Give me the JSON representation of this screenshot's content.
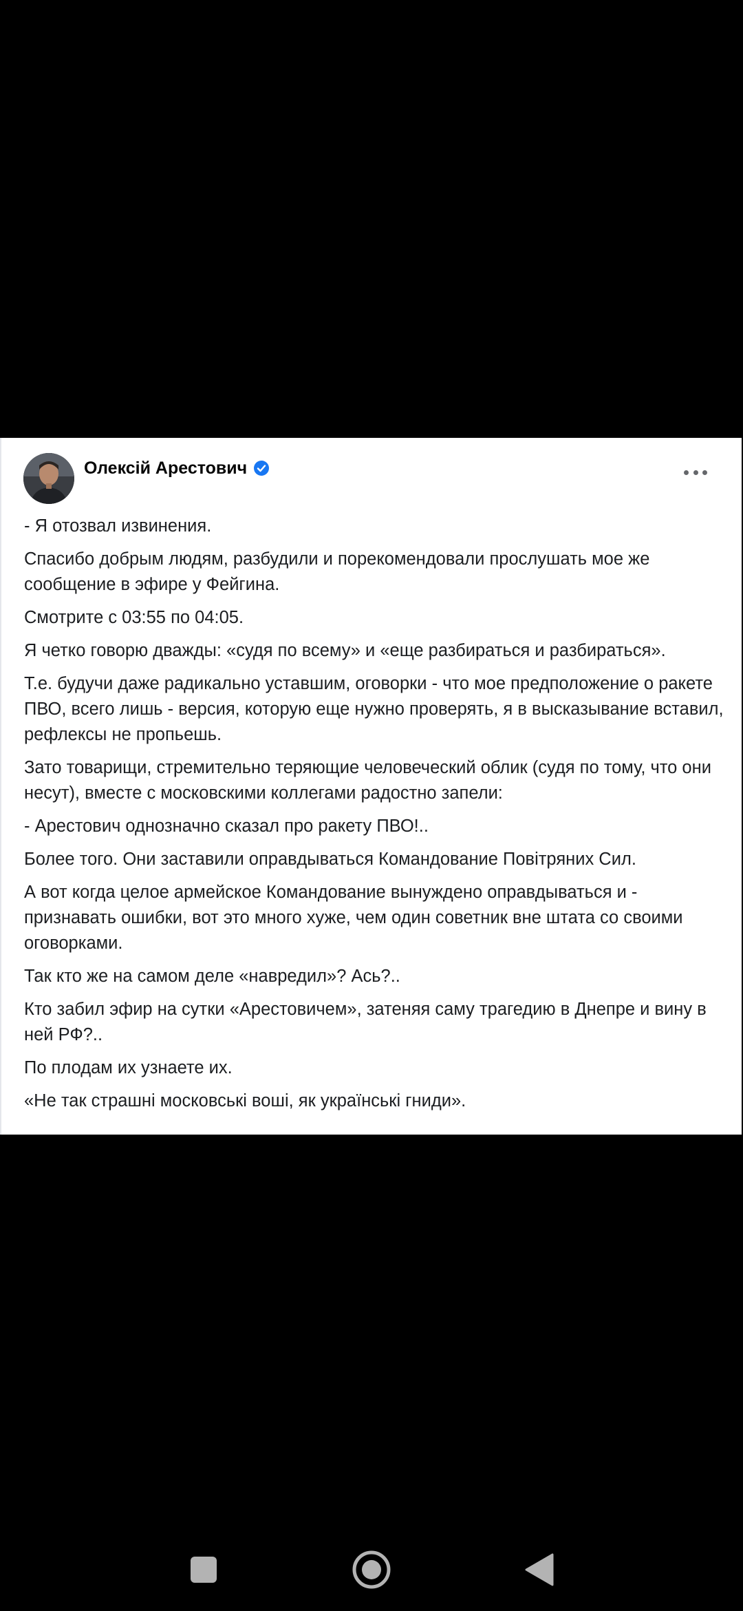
{
  "post": {
    "author": "Олексій Арестович",
    "paragraphs": [
      "- Я отозвал извинения.",
      "Спасибо добрым людям, разбудили и порекомендовали прослушать мое же сообщение в эфире у Фейгина.",
      "Смотрите с 03:55 по 04:05.",
      "Я четко говорю дважды: «судя по всему» и «еще разбираться и разбираться».",
      "Т.е. будучи даже радикально уставшим, оговорки - что мое предположение о ракете ПВО, всего лишь - версия, которую еще нужно проверять, я в высказывание вставил, рефлексы не пропьешь.",
      "Зато товарищи, стремительно теряющие человеческий облик (судя по тому, что они несут), вместе с московскими коллегами радостно запели:",
      "- Арестович однозначно сказал про ракету ПВО!..",
      "Более того. Они заставили оправдываться Командование Повітряних Сил.",
      "А вот когда целое армейское Командование вынуждено оправдываться и - признавать ошибки, вот это много хуже, чем один советник вне штата со своими оговорками.",
      "Так кто же на самом деле «навредил»? Ась?..",
      "Кто забил эфир на сутки «Арестовичем», затеняя саму трагедию в Днепре и вину в ней РФ?..",
      "По плодам их узнаете их.",
      "«Не так страшні московські воші, як українські гниди»."
    ]
  },
  "icons": {
    "verified": "verified-badge-icon",
    "more": "more-options-icon",
    "nav_recents": "square-icon",
    "nav_home": "home-circle-icon",
    "nav_back": "back-triangle-icon"
  },
  "colors": {
    "background": "#000000",
    "card": "#ffffff",
    "text": "#1c1e21",
    "verified": "#1877f2",
    "nav_icon": "#b3b3b3"
  }
}
